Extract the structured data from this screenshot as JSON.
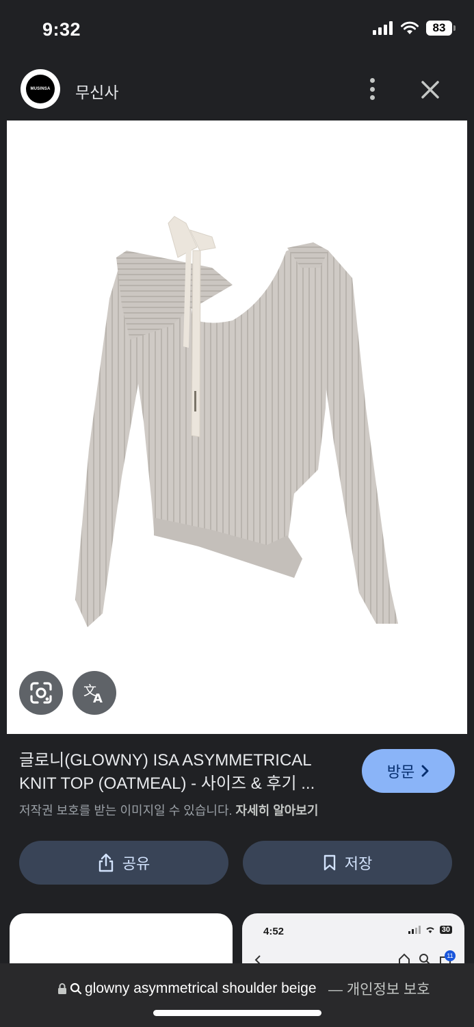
{
  "status_bar": {
    "time": "9:32",
    "battery": "83"
  },
  "header": {
    "logo_text": "MUSINSA",
    "site_name": "무신사"
  },
  "result": {
    "title": "글로니(GLOWNY) ISA ASYMMETRICAL KNIT TOP (OATMEAL) - 사이즈 & 후기 ...",
    "copyright_text": "저작권 보호를 받는 이미지일 수 있습니다.",
    "learn_more": "자세히 알아보기",
    "visit_label": "방문"
  },
  "actions": {
    "share_label": "공유",
    "save_label": "저장"
  },
  "related": {
    "card2_time": "4:52",
    "card2_battery": "30",
    "card2_badge": "11"
  },
  "bottom_bar": {
    "url": "glowny asymmetrical shoulder beige",
    "privacy_label": "— 개인정보 보호"
  },
  "colors": {
    "background": "#202124",
    "accent": "#8ab4f8",
    "button": "#394457"
  }
}
